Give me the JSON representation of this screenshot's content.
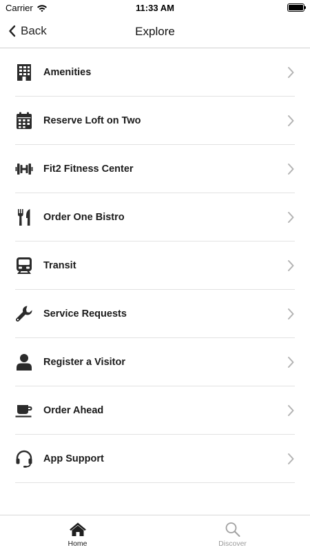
{
  "status_bar": {
    "carrier": "Carrier",
    "time": "11:33 AM"
  },
  "nav": {
    "back_label": "Back",
    "title": "Explore"
  },
  "menu": [
    {
      "label": "Amenities",
      "icon": "building-icon"
    },
    {
      "label": "Reserve Loft on Two",
      "icon": "calendar-icon"
    },
    {
      "label": "Fit2 Fitness Center",
      "icon": "dumbbell-icon"
    },
    {
      "label": "Order One Bistro",
      "icon": "utensils-icon"
    },
    {
      "label": "Transit",
      "icon": "train-icon"
    },
    {
      "label": "Service Requests",
      "icon": "wrench-icon"
    },
    {
      "label": "Register a Visitor",
      "icon": "user-icon"
    },
    {
      "label": "Order Ahead",
      "icon": "coffee-cup-icon"
    },
    {
      "label": "App Support",
      "icon": "headset-icon"
    }
  ],
  "tabs": [
    {
      "label": "Home",
      "icon": "home-icon",
      "active": true
    },
    {
      "label": "Discover",
      "icon": "search-icon",
      "active": false
    }
  ],
  "colors": {
    "icon": "#2b2b2b",
    "chevron": "#b3b3b3",
    "tab_inactive": "#9a9a9a",
    "divider": "#e2e2e2"
  }
}
